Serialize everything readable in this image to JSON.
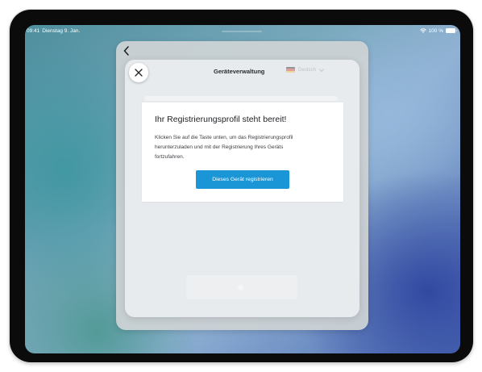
{
  "status_bar": {
    "time": "09:41",
    "date": "Dienstag 9. Jan.",
    "battery": "100 %"
  },
  "header": {
    "title": "Geräteverwaltung",
    "language_label": "Deutsch"
  },
  "card": {
    "title": "Ihr Registrierungsprofil steht bereit!",
    "body_lines": [
      "Klicken Sie auf die Taste unten, um das Registrierungsprofil",
      "herunterzuladen und mit der Registrierung Ihres Geräts",
      "fortzufahren."
    ],
    "button_label": "Dieses Gerät registrieren"
  },
  "colors": {
    "accent": "#1a95d5",
    "sheet_background": "#e8ebee",
    "card_background": "#ffffff"
  },
  "icons": {
    "back": "chevron-left-icon",
    "close": "close-icon",
    "wifi": "wifi-icon",
    "battery": "battery-icon",
    "flag": "german-flag-icon"
  }
}
